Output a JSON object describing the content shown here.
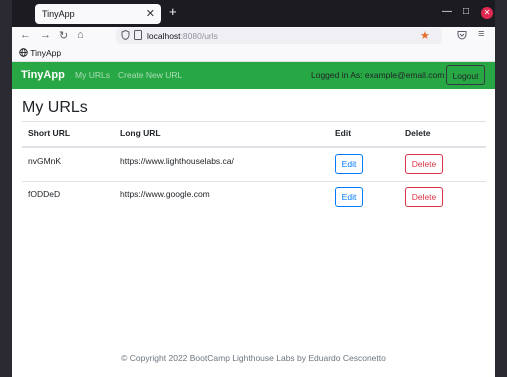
{
  "browser": {
    "tab_title": "TinyApp",
    "tab_close": "✕",
    "new_tab": "+",
    "win_min": "—",
    "win_max": "□",
    "win_close": "✕",
    "back": "←",
    "forward": "→",
    "reload": "↻",
    "home": "⌂",
    "url_host": "localhost",
    "url_path": ":8080/urls",
    "star": "★",
    "pocket": "◌",
    "menu": "≡",
    "bookmark_label": "TinyApp"
  },
  "app": {
    "brand": "TinyApp",
    "nav": [
      "My URLs",
      "Create New URL"
    ],
    "login_text": "Logged in As: example@email.com",
    "logout_label": "Logout",
    "heading": "My URLs",
    "columns": [
      "Short URL",
      "Long URL",
      "Edit",
      "Delete"
    ],
    "rows": [
      {
        "short": "nvGMnK",
        "long": "https://www.lighthouselabs.ca/",
        "edit": "Edit",
        "delete": "Delete"
      },
      {
        "short": "fODDeD",
        "long": "https://www.google.com",
        "edit": "Edit",
        "delete": "Delete"
      }
    ],
    "footer": "© Copyright 2022 BootCamp Lighthouse Labs by Eduardo Cesconetto"
  },
  "colors": {
    "navbar_green": "#28a745",
    "edit_blue": "#007bff",
    "delete_red": "#dc3545"
  }
}
